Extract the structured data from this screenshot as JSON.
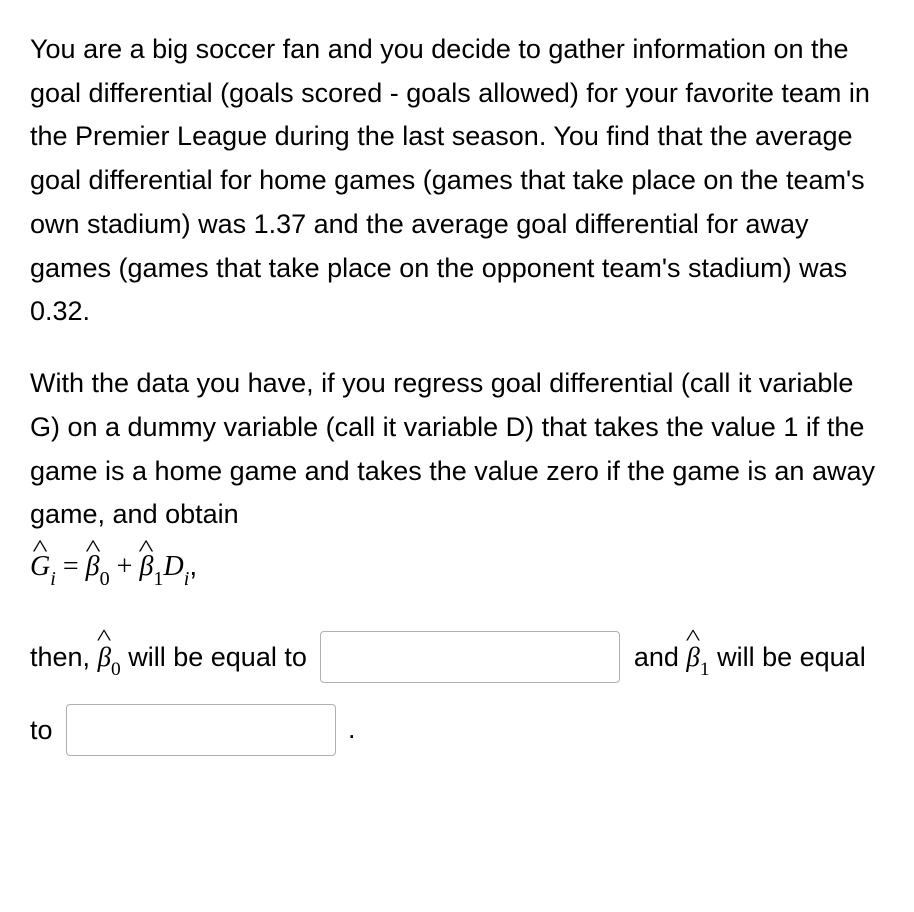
{
  "paragraph1": "You are a big soccer fan and you decide to gather information on the goal differential (goals scored - goals allowed) for your favorite team in the Premier League during the last season. You find that the average goal differential for home games (games that take place on the team's own stadium) was 1.37 and the average goal differential for away games (games that take place on the opponent team's stadium) was 0.32.",
  "paragraph2_part1": "With the data you have, if you regress goal differential (call it variable G) on a dummy variable (call it variable D) that takes the value 1 if the game is a home game and takes the value zero if the game is an away game, and obtain",
  "equation": {
    "lhs_var": "G",
    "lhs_sub": "i",
    "equals": " = ",
    "b0_var": "β",
    "b0_sub": "0",
    "plus": " + ",
    "b1_var": "β",
    "b1_sub": "1",
    "d_var": "D",
    "d_sub": "i",
    "trail": ","
  },
  "answer": {
    "prefix": "then, ",
    "b0_var": "β",
    "b0_sub": "0",
    "mid1": " will be equal to ",
    "mid2": " and ",
    "b1_var": "β",
    "b1_sub": "1",
    "mid3": " will be equal to ",
    "period": "."
  },
  "inputs": {
    "beta0_value": "",
    "beta1_value": ""
  }
}
